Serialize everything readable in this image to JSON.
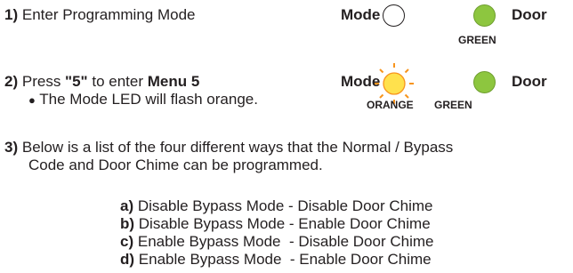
{
  "steps": {
    "s1": {
      "num": "1)",
      "text": "Enter Programming Mode"
    },
    "s2": {
      "num": "2)",
      "pre": "Press ",
      "key": "\"5\"",
      "mid": " to enter ",
      "menu": "Menu 5",
      "bullet": "●",
      "note": "The Mode LED will flash orange."
    },
    "s3": {
      "num": "3)",
      "line1": "Below is a list of the four different ways that the Normal / Bypass",
      "line2": "Code and Door Chime can be programmed."
    }
  },
  "panel1": {
    "mode_label": "Mode",
    "door_label": "Door",
    "door_color_label": "GREEN",
    "mode_led_color": "#ffffff",
    "door_led_color": "#8dc63f"
  },
  "panel2": {
    "mode_label": "Mode",
    "door_label": "Door",
    "mode_color_label": "ORANGE",
    "door_color_label": "GREEN",
    "mode_led_color": "#ffe14d",
    "mode_ray_color": "#f7941d",
    "door_led_color": "#8dc63f"
  },
  "options": [
    {
      "letter": "a)",
      "text": "Disable Bypass Mode - Disable Door Chime"
    },
    {
      "letter": "b)",
      "text": "Disable Bypass Mode - Enable Door Chime"
    },
    {
      "letter": "c)",
      "text": "Enable Bypass Mode  - Disable Door Chime"
    },
    {
      "letter": "d)",
      "text": "Enable Bypass Mode  - Enable Door Chime"
    }
  ]
}
